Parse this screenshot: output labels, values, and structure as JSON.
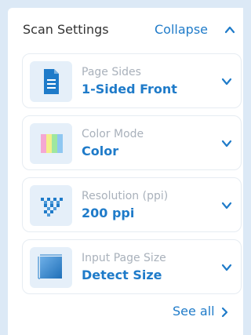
{
  "header": {
    "title": "Scan Settings",
    "collapse_label": "Collapse"
  },
  "settings": [
    {
      "label": "Page Sides",
      "value": "1-Sided Front",
      "icon": "document-icon"
    },
    {
      "label": "Color Mode",
      "value": "Color",
      "icon": "color-bars-icon"
    },
    {
      "label": "Resolution (ppi)",
      "value": "200 ppi",
      "icon": "pixel-grid-icon"
    },
    {
      "label": "Input Page Size",
      "value": "Detect Size",
      "icon": "page-size-icon"
    }
  ],
  "footer": {
    "see_all_label": "See all"
  },
  "colors": {
    "accent": "#1f7bc9",
    "label": "#a9b1bb",
    "background": "#dce9f6"
  }
}
